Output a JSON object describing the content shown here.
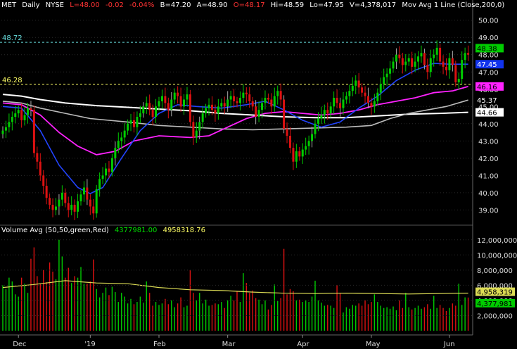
{
  "header": {
    "symbol": "MET",
    "interval": "Daily",
    "exchange": "NYSE",
    "last": "L=48.00",
    "change": "-0.02",
    "change_pct": "-0.04%",
    "bid": "B=47.20",
    "ask": "A=48.90",
    "open": "O=48.17",
    "high": "Hi=48.59",
    "low": "Lo=47.95",
    "volume": "V=4,378,017",
    "study": "Mov Avg 1 Line (Close,200,0)"
  },
  "volume_header": {
    "label": "Volume Avg (50,50,green,Red)",
    "value1": "4377981.00",
    "value2": "4958318.76"
  },
  "colors": {
    "up": "#00cc00",
    "down": "#dd1111",
    "ma_short": "#2244ff",
    "ma_mid": "#ff22ff",
    "ma_200": "#ffffff",
    "ma_long": "#bbbbbb",
    "vol_avg": "#dddd55",
    "level_line": "#ffff66"
  },
  "chart_data": {
    "type": "candlestick",
    "x_labels": [
      "Dec",
      "'19",
      "Feb",
      "Mar",
      "Apr",
      "May",
      "Jun"
    ],
    "y_ticks": [
      39.0,
      40.0,
      41.0,
      42.0,
      43.0,
      44.0,
      45.0,
      46.0,
      47.0,
      48.0,
      49.0,
      50.0
    ],
    "ylim": [
      38.2,
      50.6
    ],
    "levels": [
      {
        "value": 48.72,
        "label": "48.72",
        "color": "#66dddd"
      },
      {
        "value": 46.28,
        "label": "46.28",
        "color": "#ffff66"
      }
    ],
    "right_labels": [
      {
        "value": 48.38,
        "label": "48.38",
        "bg": "#00cc00",
        "fg": "#000000"
      },
      {
        "value": 47.45,
        "label": "47.45",
        "bg": "#1133ee",
        "fg": "#ffffff"
      },
      {
        "value": 46.16,
        "label": "46.16",
        "bg": "#ff22ff",
        "fg": "#000000"
      },
      {
        "value": 45.37,
        "label": "45.37",
        "bg": "#000000",
        "fg": "#ffffff"
      },
      {
        "value": 44.66,
        "label": "44.66",
        "bg": "#ffffff",
        "fg": "#000000"
      }
    ],
    "closes": [
      43.6,
      43.8,
      44.1,
      44.4,
      44.6,
      44.8,
      44.2,
      44.5,
      44.9,
      44.8,
      42.3,
      41.8,
      41.0,
      40.4,
      39.7,
      39.3,
      39.0,
      39.2,
      39.6,
      40.0,
      39.4,
      39.0,
      39.3,
      38.9,
      39.5,
      39.9,
      40.3,
      39.6,
      39.2,
      38.8,
      40.2,
      40.8,
      41.0,
      41.4,
      41.2,
      42.0,
      42.6,
      43.0,
      43.2,
      43.6,
      44.0,
      44.2,
      43.8,
      44.4,
      44.6,
      45.0,
      45.2,
      44.8,
      44.4,
      45.0,
      45.3,
      45.6,
      45.2,
      44.8,
      45.4,
      45.8,
      45.6,
      45.0,
      45.4,
      45.7,
      44.1,
      43.2,
      43.6,
      44.1,
      44.6,
      44.9,
      45.1,
      44.8,
      44.6,
      45.0,
      45.2,
      45.0,
      45.4,
      45.6,
      45.3,
      45.2,
      45.5,
      45.8,
      45.7,
      45.3,
      45.0,
      44.4,
      44.8,
      45.2,
      45.5,
      45.4,
      45.0,
      45.6,
      45.9,
      45.4,
      43.7,
      43.3,
      42.6,
      41.8,
      42.4,
      42.1,
      42.5,
      42.7,
      43.0,
      43.4,
      44.0,
      44.3,
      44.5,
      44.8,
      44.6,
      45.0,
      45.5,
      45.2,
      44.9,
      45.4,
      45.6,
      45.9,
      46.2,
      46.5,
      46.1,
      45.8,
      45.6,
      45.2,
      45.0,
      45.3,
      45.8,
      46.3,
      46.7,
      46.9,
      47.2,
      47.6,
      48.0,
      47.8,
      47.4,
      47.6,
      47.8,
      47.3,
      47.6,
      47.9,
      48.1,
      47.4,
      47.0,
      47.8,
      48.0,
      48.4,
      47.6,
      47.3,
      47.1,
      47.8,
      47.4,
      46.4,
      46.6,
      47.7,
      48.1,
      48.0
    ],
    "ma_short": {
      "name": "",
      "points": [
        [
          0,
          45.0
        ],
        [
          6,
          44.9
        ],
        [
          12,
          43.6
        ],
        [
          18,
          41.6
        ],
        [
          24,
          40.3
        ],
        [
          28,
          39.95
        ],
        [
          32,
          40.3
        ],
        [
          38,
          42.0
        ],
        [
          44,
          43.6
        ],
        [
          50,
          44.6
        ],
        [
          56,
          45.1
        ],
        [
          62,
          45.0
        ],
        [
          70,
          44.9
        ],
        [
          78,
          45.1
        ],
        [
          84,
          45.3
        ],
        [
          90,
          44.8
        ],
        [
          96,
          44.2
        ],
        [
          102,
          43.8
        ],
        [
          108,
          44.1
        ],
        [
          114,
          44.9
        ],
        [
          120,
          45.6
        ],
        [
          126,
          46.5
        ],
        [
          132,
          47.1
        ],
        [
          138,
          47.5
        ],
        [
          143,
          47.45
        ],
        [
          149,
          47.45
        ]
      ]
    },
    "ma_mid": {
      "name": "",
      "points": [
        [
          0,
          45.2
        ],
        [
          6,
          45.1
        ],
        [
          12,
          44.5
        ],
        [
          18,
          43.5
        ],
        [
          24,
          42.7
        ],
        [
          30,
          42.2
        ],
        [
          36,
          42.4
        ],
        [
          42,
          43.0
        ],
        [
          50,
          43.3
        ],
        [
          60,
          43.2
        ],
        [
          66,
          43.3
        ],
        [
          72,
          43.8
        ],
        [
          78,
          44.3
        ],
        [
          84,
          44.6
        ],
        [
          90,
          44.7
        ],
        [
          96,
          44.6
        ],
        [
          102,
          44.5
        ],
        [
          108,
          44.6
        ],
        [
          114,
          44.8
        ],
        [
          120,
          45.1
        ],
        [
          126,
          45.3
        ],
        [
          132,
          45.5
        ],
        [
          138,
          45.8
        ],
        [
          144,
          45.9
        ],
        [
          149,
          46.16
        ]
      ]
    },
    "ma_long": {
      "name": "",
      "points": [
        [
          0,
          45.3
        ],
        [
          6,
          45.2
        ],
        [
          12,
          44.9
        ],
        [
          20,
          44.6
        ],
        [
          28,
          44.3
        ],
        [
          40,
          44.1
        ],
        [
          50,
          43.9
        ],
        [
          60,
          43.8
        ],
        [
          70,
          43.7
        ],
        [
          80,
          43.65
        ],
        [
          90,
          43.7
        ],
        [
          100,
          43.75
        ],
        [
          110,
          43.8
        ],
        [
          118,
          43.9
        ],
        [
          124,
          44.3
        ],
        [
          130,
          44.6
        ],
        [
          136,
          44.8
        ],
        [
          142,
          45.0
        ],
        [
          149,
          45.37
        ]
      ]
    },
    "ma_200": {
      "name": "",
      "points": [
        [
          0,
          45.7
        ],
        [
          6,
          45.6
        ],
        [
          12,
          45.4
        ],
        [
          20,
          45.2
        ],
        [
          30,
          45.05
        ],
        [
          40,
          44.95
        ],
        [
          50,
          44.85
        ],
        [
          60,
          44.75
        ],
        [
          70,
          44.6
        ],
        [
          80,
          44.5
        ],
        [
          90,
          44.4
        ],
        [
          100,
          44.35
        ],
        [
          110,
          44.35
        ],
        [
          120,
          44.45
        ],
        [
          130,
          44.55
        ],
        [
          140,
          44.6
        ],
        [
          149,
          44.66
        ]
      ]
    },
    "volume": {
      "y_ticks": [
        2000000,
        4000000,
        6000000,
        8000000,
        10000000,
        12000000
      ],
      "y_tick_labels": [
        "2,000,000",
        "4,000,000",
        "6,000,000",
        "8,000,000",
        "10,000,000",
        "12,000,000"
      ],
      "ylim": [
        0,
        13000000
      ],
      "right_labels": [
        {
          "value": 4958319,
          "label": "4,958,319",
          "bg": "#dddd55",
          "fg": "#000000"
        },
        {
          "value": 4377981,
          "label": "4,377,981",
          "bg": "#00cc00",
          "fg": "#000000"
        }
      ],
      "values": [
        6000000,
        5500000,
        7000000,
        6500000,
        4800000,
        4500000,
        7000000,
        6200000,
        5000000,
        9500000,
        11000000,
        7200000,
        6200000,
        8000000,
        6400000,
        9000000,
        7800000,
        6800000,
        12000000,
        9800000,
        7000000,
        8300000,
        6300000,
        7200000,
        7000000,
        8400000,
        6200000,
        6200000,
        6500000,
        9400000,
        5500000,
        4400000,
        5000000,
        5700000,
        4700000,
        5800000,
        5100000,
        3800000,
        5000000,
        4500000,
        3600000,
        4200000,
        3500000,
        3800000,
        4500000,
        3700000,
        6500000,
        5000000,
        3300000,
        3800000,
        3400000,
        3600000,
        4200000,
        3500000,
        4000000,
        3100000,
        3600000,
        4400000,
        3100000,
        3300000,
        8000000,
        5000000,
        4000000,
        5000000,
        3600000,
        4100000,
        3300000,
        3400000,
        3600000,
        3500000,
        3800000,
        3000000,
        4000000,
        4600000,
        4000000,
        5200000,
        3800000,
        7600000,
        6300000,
        5000000,
        5300000,
        4300000,
        4100000,
        3500000,
        4000000,
        2800000,
        3400000,
        6100000,
        3900000,
        4300000,
        10800000,
        4800000,
        5500000,
        5200000,
        4000000,
        4100000,
        3800000,
        4000000,
        3800000,
        4500000,
        6600000,
        4000000,
        3700000,
        3300000,
        3400000,
        3300000,
        3000000,
        6000000,
        5000000,
        2400000,
        3100000,
        2900000,
        3400000,
        3300000,
        3600000,
        3300000,
        4000000,
        3500000,
        3800000,
        4800000,
        3800000,
        3300000,
        3000000,
        3100000,
        2900000,
        3200000,
        2700000,
        4000000,
        3000000,
        5000000,
        3100000,
        2800000,
        3000000,
        3300000,
        2900000,
        3100000,
        3500000,
        2900000,
        4600000,
        3000000,
        3400000,
        3000000,
        2600000,
        3000000,
        3600000,
        3300000,
        6200000,
        3400000,
        4400000,
        4378017
      ],
      "avg_points": [
        [
          0,
          5700000
        ],
        [
          10,
          6100000
        ],
        [
          20,
          6600000
        ],
        [
          30,
          6300000
        ],
        [
          40,
          6200000
        ],
        [
          50,
          5700000
        ],
        [
          60,
          5400000
        ],
        [
          70,
          5300000
        ],
        [
          80,
          5100000
        ],
        [
          90,
          4950000
        ],
        [
          100,
          4900000
        ],
        [
          110,
          4950000
        ],
        [
          120,
          4900000
        ],
        [
          130,
          4850000
        ],
        [
          140,
          4900000
        ],
        [
          149,
          4958319
        ]
      ]
    }
  }
}
